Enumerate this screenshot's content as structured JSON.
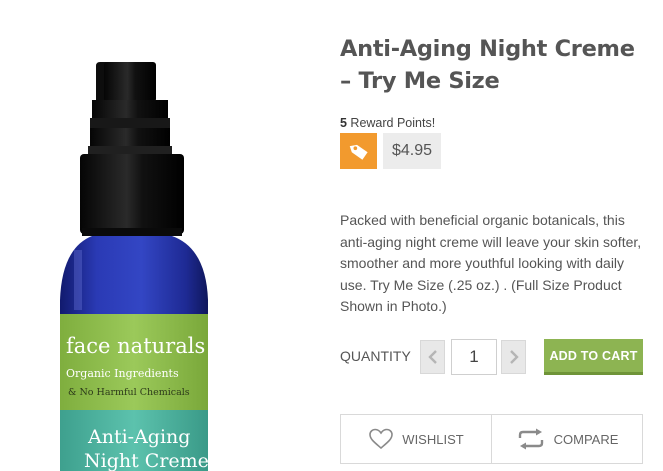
{
  "product": {
    "title": "Anti-Aging Night Creme – Try Me Size",
    "reward_points": "5",
    "reward_label": " Reward Points!",
    "price": "$4.95",
    "description": "Packed with beneficial organic botanicals, this anti-aging night creme will leave your skin softer, smoother and more youthful looking with daily use. Try Me Size (.25 oz.) . (Full Size Product Shown in Photo.)",
    "tag_icon": "price-tag-icon"
  },
  "image": {
    "brand_line1": "face naturals",
    "brand_line2": "Organic Ingredients",
    "brand_line3": "& No Harmful Chemicals",
    "label_line1": "Anti-Aging",
    "label_line2": "Night Creme"
  },
  "cart": {
    "quantity_label": "QUANTITY",
    "quantity_value": "1",
    "add_to_cart_label": "ADD TO CART",
    "minus_icon": "chevron-left-icon",
    "plus_icon": "chevron-right-icon"
  },
  "actions": {
    "wishlist_label": "WISHLIST",
    "compare_label": "COMPARE",
    "wishlist_icon": "heart-icon",
    "compare_icon": "repeat-arrows-icon"
  },
  "colors": {
    "accent_orange": "#f29a2e",
    "cart_green": "#8db452",
    "label_green": "#8cbd4b",
    "label_teal": "#4fb8a3",
    "bottle_blue": "#2433a8"
  }
}
